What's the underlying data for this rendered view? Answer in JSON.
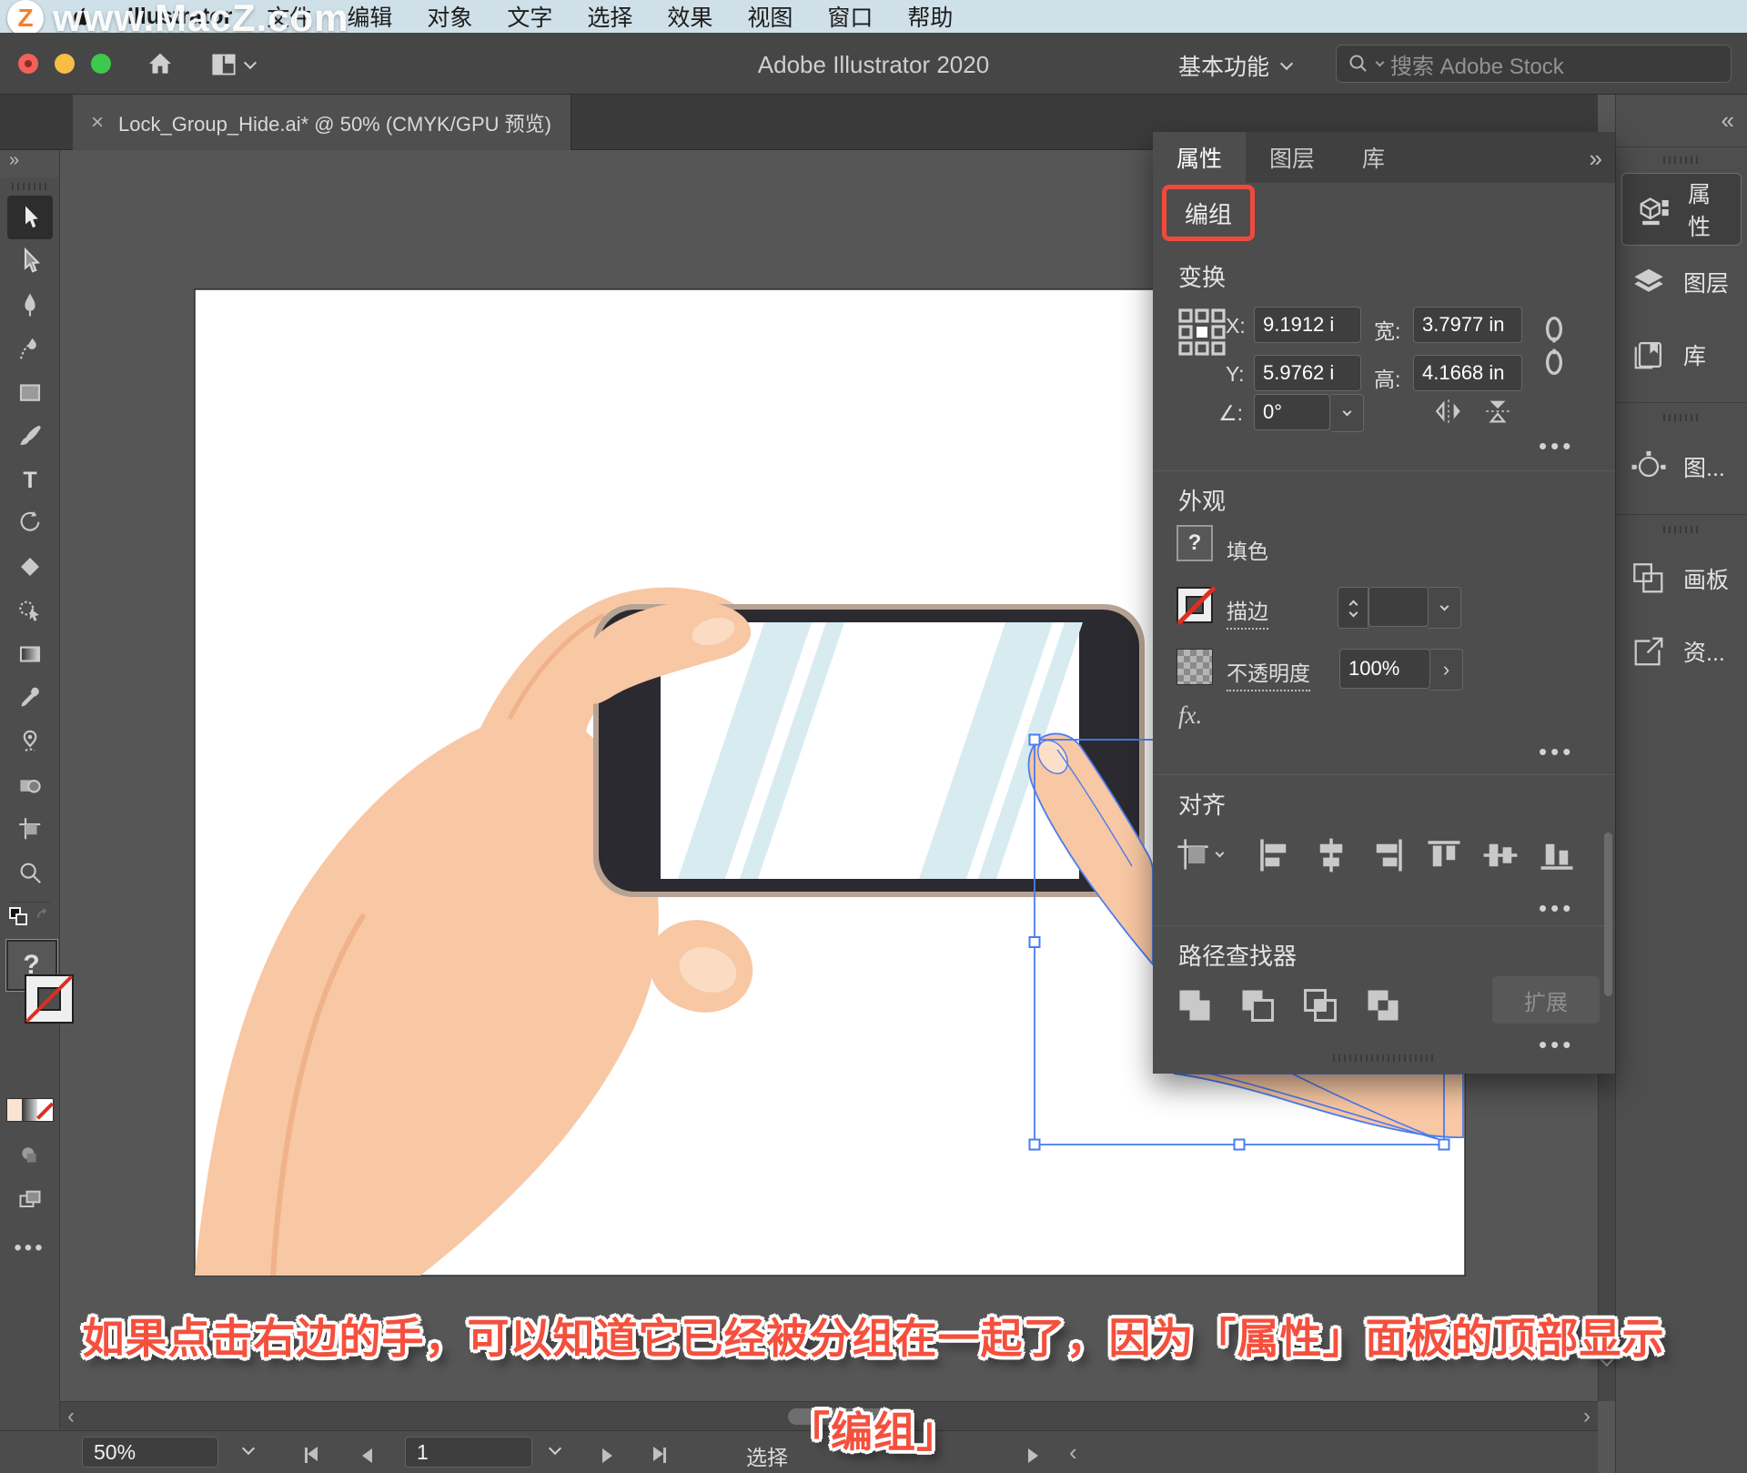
{
  "colors": {
    "accent_red": "#EF4A3D",
    "selection_blue": "#4A7CF0",
    "caption_red": "#F4503E",
    "menubar_bg": "#CFE0E8",
    "skin": "#F8C7A3"
  },
  "watermark": {
    "logo_letter": "Z",
    "text": "www.MacZ.com"
  },
  "menubar": {
    "app_name": "Illustrator",
    "items": [
      "文件",
      "编辑",
      "对象",
      "文字",
      "选择",
      "效果",
      "视图",
      "窗口",
      "帮助"
    ]
  },
  "titlebar": {
    "title": "Adobe Illustrator 2020",
    "workspace": "基本功能",
    "search_placeholder": "搜索 Adobe Stock"
  },
  "tabbar": {
    "close": "×",
    "doc_title": "Lock_Group_Hide.ai* @ 50% (CMYK/GPU 预览)"
  },
  "toolbar": {
    "expand": "»",
    "fill_unknown": "?",
    "tools": [
      "selection-tool",
      "direct-selection-tool",
      "pen-tool",
      "curvature-tool",
      "rectangle-tool",
      "paintbrush-tool",
      "type-tool",
      "rotate-tool",
      "eraser-tool",
      "shaper-tool",
      "gradient-tool",
      "eyedropper-tool",
      "puppet-warp-tool",
      "shape-builder-tool",
      "artboard-tool",
      "zoom-tool"
    ]
  },
  "panel": {
    "tabs": [
      "属性",
      "图层",
      "库"
    ],
    "more": "»",
    "selection_type": "编组",
    "transform": {
      "title": "变换",
      "x_label": "X:",
      "x_value": "9.1912 i",
      "y_label": "Y:",
      "y_value": "5.9762 i",
      "w_label": "宽:",
      "w_value": "3.7977 in",
      "h_label": "高:",
      "h_value": "4.1668 in",
      "angle_label": "∠:",
      "angle_value": "0°"
    },
    "appearance": {
      "title": "外观",
      "fill_label": "填色",
      "fill_mark": "?",
      "stroke_label": "描边",
      "opacity_label": "不透明度",
      "opacity_value": "100%",
      "fx_label": "fx."
    },
    "align": {
      "title": "对齐"
    },
    "pathfinder": {
      "title": "路径查找器",
      "expand_button": "扩展"
    }
  },
  "dock": {
    "collapse": "«",
    "items": [
      {
        "label": "属性"
      },
      {
        "label": "图层"
      },
      {
        "label": "库"
      },
      {
        "label": "图..."
      },
      {
        "label": "画板"
      },
      {
        "label": "资..."
      }
    ]
  },
  "statusbar": {
    "zoom": "50%",
    "page": "1",
    "status": "选择"
  },
  "caption": {
    "line1": "如果点击右边的手，可以知道它已经被分组在一起了，因为「属性」面板的顶部显示",
    "line2": "「编组」"
  }
}
